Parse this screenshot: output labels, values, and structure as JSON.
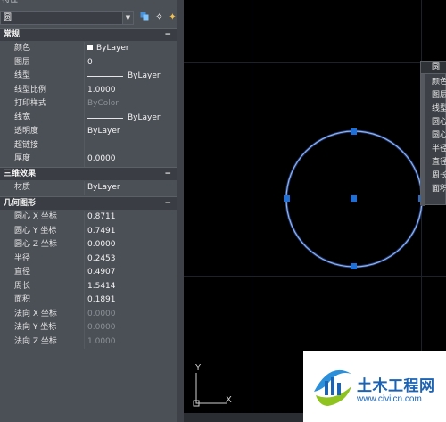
{
  "palette": {
    "title": "特性",
    "object_type": "圆",
    "sections": {
      "general": {
        "title": "常规",
        "toggle": "−"
      },
      "threed": {
        "title": "三维效果",
        "toggle": "−"
      },
      "geometry": {
        "title": "几何图形",
        "toggle": "−"
      }
    },
    "general_rows": [
      {
        "label": "颜色",
        "value": "ByLayer"
      },
      {
        "label": "图层",
        "value": "0"
      },
      {
        "label": "线型",
        "value": "ByLayer"
      },
      {
        "label": "线型比例",
        "value": "1.0000"
      },
      {
        "label": "打印样式",
        "value": "ByColor"
      },
      {
        "label": "线宽",
        "value": "ByLayer"
      },
      {
        "label": "透明度",
        "value": "ByLayer"
      },
      {
        "label": "超链接",
        "value": ""
      },
      {
        "label": "厚度",
        "value": "0.0000"
      }
    ],
    "threed_rows": [
      {
        "label": "材质",
        "value": "ByLayer"
      }
    ],
    "geometry_rows": [
      {
        "label": "圆心 X 坐标",
        "value": "0.8711"
      },
      {
        "label": "圆心 Y 坐标",
        "value": "0.7491"
      },
      {
        "label": "圆心 Z 坐标",
        "value": "0.0000"
      },
      {
        "label": "半径",
        "value": "0.2453"
      },
      {
        "label": "直径",
        "value": "0.4907"
      },
      {
        "label": "周长",
        "value": "1.5414"
      },
      {
        "label": "面积",
        "value": "0.1891"
      },
      {
        "label": "法向 X 坐标",
        "value": "0.0000"
      },
      {
        "label": "法向 Y 坐标",
        "value": "0.0000"
      },
      {
        "label": "法向 Z 坐标",
        "value": "1.0000"
      }
    ]
  },
  "quick_properties": {
    "title": "圆",
    "rows": [
      "颜色",
      "图层",
      "线型",
      "圆心",
      "圆心",
      "半径",
      "直径",
      "周长",
      "面积"
    ]
  },
  "ucs": {
    "x_label": "X",
    "y_label": "Y"
  },
  "watermark": {
    "title": "土木工程网",
    "url": "www.civilcn.com"
  },
  "colors": {
    "circle": "#7aa8e6",
    "grip": "#1f6fd6",
    "palette_bg": "#4b4f56",
    "section_bg": "#3a3d43"
  }
}
